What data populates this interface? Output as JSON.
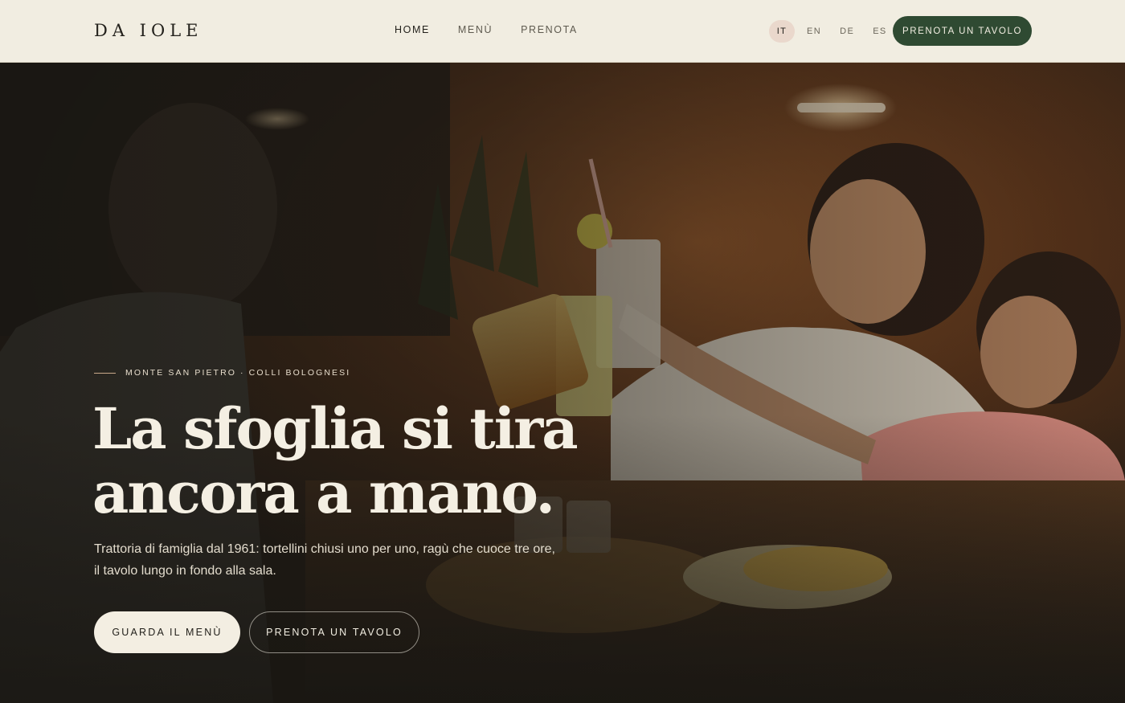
{
  "header": {
    "logo": "DA IOLE",
    "nav": [
      {
        "label": "HOME",
        "active": true
      },
      {
        "label": "MENÙ",
        "active": false
      },
      {
        "label": "PRENOTA",
        "active": false
      }
    ],
    "languages": [
      {
        "label": "IT",
        "active": true
      },
      {
        "label": "EN",
        "active": false
      },
      {
        "label": "DE",
        "active": false
      },
      {
        "label": "ES",
        "active": false
      }
    ],
    "cta_label": "PRENOTA UN TAVOLO"
  },
  "hero": {
    "eyebrow": "MONTE SAN PIETRO · COLLI BOLOGNESI",
    "headline_line1": "La sfoglia si tira",
    "headline_line2": "ancora a mano.",
    "lead_line1": "Trattoria di famiglia dal 1961: tortellini chiusi uno per uno, ragù che cuoce tre ore,",
    "lead_line2": "il tavolo lungo in fondo alla sala.",
    "primary_button": "GUARDA IL MENÙ",
    "secondary_button": "PRENOTA UN TAVOLO"
  },
  "colors": {
    "header_bg": "#f1ede1",
    "accent_green": "#2f4a32",
    "lang_active_bg": "#ead8cc",
    "hero_text": "#f4efe3"
  }
}
